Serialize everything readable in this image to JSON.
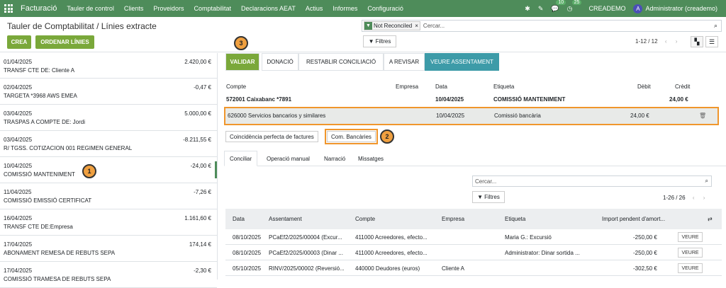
{
  "topbar": {
    "brand": "Facturació",
    "menus": [
      "Tauler de control",
      "Clients",
      "Proveidors",
      "Comptabilitat",
      "Declaracions AEAT",
      "Actius",
      "Informes",
      "Configuració"
    ],
    "chat_count": "10",
    "activity_count": "25",
    "company": "CREADEMO",
    "avatar_letter": "A",
    "user": "Administrator (creademo)"
  },
  "control": {
    "breadcrumb": "Tauler de Comptabilitat / Línies extracte",
    "create": "CREA",
    "order": "ORDENAR LÍNIES",
    "facet": "Not Reconciled",
    "search_placeholder": "Cercar...",
    "filters": "Filtres",
    "pager": "1-12 / 12"
  },
  "lines": [
    {
      "date": "01/04/2025",
      "label": "TRANSF CTE DE: Cliente A",
      "amount": "2.420,00 €"
    },
    {
      "date": "02/04/2025",
      "label": "TARGETA *3968 AWS EMEA",
      "amount": "-0,47 €"
    },
    {
      "date": "03/04/2025",
      "label": "TRASPAS A COMPTE DE: Jordi",
      "amount": "5.000,00 €"
    },
    {
      "date": "03/04/2025",
      "label": "R/ TGSS. COTIZACION 001 REGIMEN GENERAL",
      "amount": "-8.211,55 €"
    },
    {
      "date": "10/04/2025",
      "label": "COMISSIÓ MANTENIMENT",
      "amount": "-24,00 €"
    },
    {
      "date": "11/04/2025",
      "label": "COMISSIÓ EMISSIÓ CERTIFICAT",
      "amount": "-7,26 €"
    },
    {
      "date": "16/04/2025",
      "label": "TRANSF CTE DE:Empresa",
      "amount": "1.161,60 €"
    },
    {
      "date": "17/04/2025",
      "label": "ABONAMENT REMESA DE REBUTS SEPA",
      "amount": "174,14 €"
    },
    {
      "date": "17/04/2025",
      "label": "COMISSIÓ TRAMESA DE REBUTS SEPA",
      "amount": "-2,30 €"
    }
  ],
  "actions": {
    "validate": "VALIDAR",
    "donate": "DONACIÓ",
    "reset": "RESTABLIR CONCILIACIÓ",
    "review": "A REVISAR",
    "view_entry": "VEURE ASSENTAMENT"
  },
  "entry_headers": {
    "account": "Compte",
    "company": "Empresa",
    "date": "Data",
    "label": "Etiqueta",
    "debit": "Dèbit",
    "credit": "Crèdit"
  },
  "entry_row1": {
    "account": "572001 Caixabanc *7891",
    "date": "10/04/2025",
    "label": "COMISSIÓ MANTENIMENT",
    "credit": "24,00 €"
  },
  "entry_row2": {
    "account": "626000 Servicios bancarios y similares",
    "date": "10/04/2025",
    "label": "Comissió bancària",
    "debit": "24,00 €"
  },
  "chips": {
    "perfect": "Coincidència perfecta de factures",
    "bank": "Com. Bancàries"
  },
  "subtabs": [
    "Conciliar",
    "Operació manual",
    "Narració",
    "Missatges"
  ],
  "table": {
    "search_placeholder": "Cercar...",
    "filters": "Filtres",
    "pager": "1-26 / 26",
    "headers": {
      "date": "Data",
      "entry": "Assentament",
      "account": "Compte",
      "company": "Empresa",
      "label": "Etiqueta",
      "amount": "Import pendent d'amort..."
    },
    "view": "VEURE",
    "rows": [
      {
        "date": "08/10/2025",
        "entry": "PCaEf2/2025/00004 (Excur...",
        "account": "411000 Acreedores, efecto...",
        "company": "",
        "label": "Maria G.: Excursió",
        "amount": "-250,00 €"
      },
      {
        "date": "08/10/2025",
        "entry": "PCaEf2/2025/00003 (Dinar ...",
        "account": "411000 Acreedores, efecto...",
        "company": "",
        "label": "Administrator: Dinar sortida ...",
        "amount": "-250,00 €"
      },
      {
        "date": "05/10/2025",
        "entry": "RINV/2025/00002 (Reversió...",
        "account": "440000 Deudores (euros)",
        "company": "Cliente A",
        "label": "",
        "amount": "-302,50 €"
      }
    ]
  },
  "callouts": [
    "1",
    "2",
    "3"
  ],
  "colors": {
    "topbar": "#4e8c5a",
    "primary": "#7aa83a",
    "highlight": "#f0962c",
    "info": "#3d9ba8"
  }
}
